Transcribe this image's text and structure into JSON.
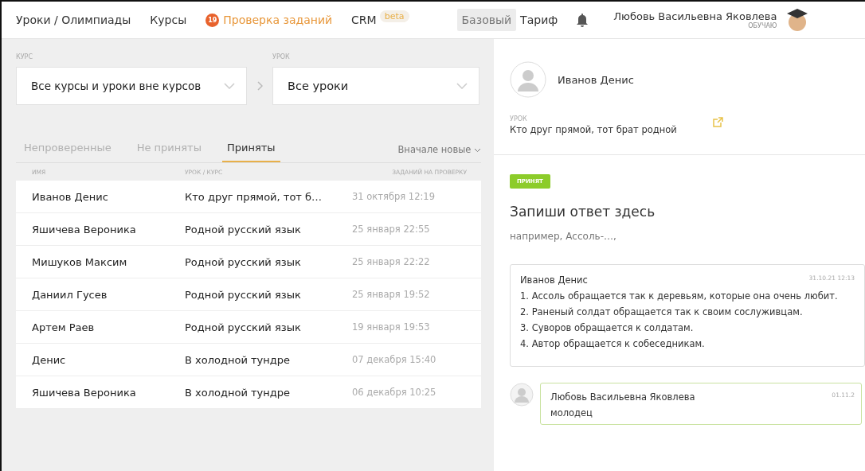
{
  "nav": {
    "items": [
      {
        "label": "Уроки / Олимпиады",
        "kind": "link",
        "selected": false
      },
      {
        "label": "Курсы",
        "kind": "link",
        "selected": false
      },
      {
        "label": "Проверка заданий",
        "kind": "counter",
        "count": "19",
        "selected": true
      },
      {
        "label": "CRM",
        "kind": "beta",
        "tag": "beta",
        "selected": false
      }
    ],
    "plan": {
      "badge": "Базовый",
      "label": "Тариф"
    },
    "user": {
      "name": "Любовь Васильевна Яковлева",
      "role": "ОБУЧАЮ"
    }
  },
  "filters": [
    {
      "label": "КУРС",
      "value": "Все курсы и уроки вне курсов"
    },
    {
      "label": "УРОК",
      "value": "Все уроки"
    }
  ],
  "tabs": [
    {
      "label": "Непроверенные",
      "selected": false
    },
    {
      "label": "Не приняты",
      "selected": false
    },
    {
      "label": "Приняты",
      "selected": true
    }
  ],
  "sort": "Вначале новые",
  "table": {
    "columns": [
      "ИМЯ",
      "УРОК / КУРС",
      "ЗАДАНИЙ НА ПРОВЕРКУ"
    ],
    "rows": [
      [
        "Иванов Денис",
        "Кто друг прямой, тот б…",
        "31 октября 12:19"
      ],
      [
        "Яшичева Вероника",
        "Родной русский язык",
        "25 января 22:55"
      ],
      [
        "Мишуков Максим",
        "Родной русский язык",
        "25 января 22:22"
      ],
      [
        "Даниил Гусев",
        "Родной русский язык",
        "25 января 19:52"
      ],
      [
        "Артем Раев",
        "Родной русский язык",
        "19 января 19:53"
      ],
      [
        "Денис",
        "В холодной тундре",
        "07 декабря 15:40"
      ],
      [
        "Яшичева Вероника",
        "В холодной тундре",
        "06 декабря 10:25"
      ]
    ]
  },
  "detail": {
    "student": "Иванов Денис",
    "lesson_label": "УРОК",
    "lesson": "Кто друг прямой, тот брат родной",
    "status": "ПРИНЯТ",
    "task_title": "Запиши ответ здесь",
    "task_hint": "например, Ассоль-…,",
    "answer": {
      "author": "Иванов Денис",
      "time": "31.10.21 12:13",
      "lines": [
        "1. Ассоль обращается так к деревьям, которые она очень любит.",
        "2. Раненый солдат обращается так к своим сослуживцам.",
        "3. Суворов обращается к солдатам.",
        "4. Автор обращается к собеседникам."
      ]
    },
    "comment": {
      "author": "Любовь Васильевна Яковлева",
      "time": "01.11.2",
      "text": "молодец"
    }
  }
}
